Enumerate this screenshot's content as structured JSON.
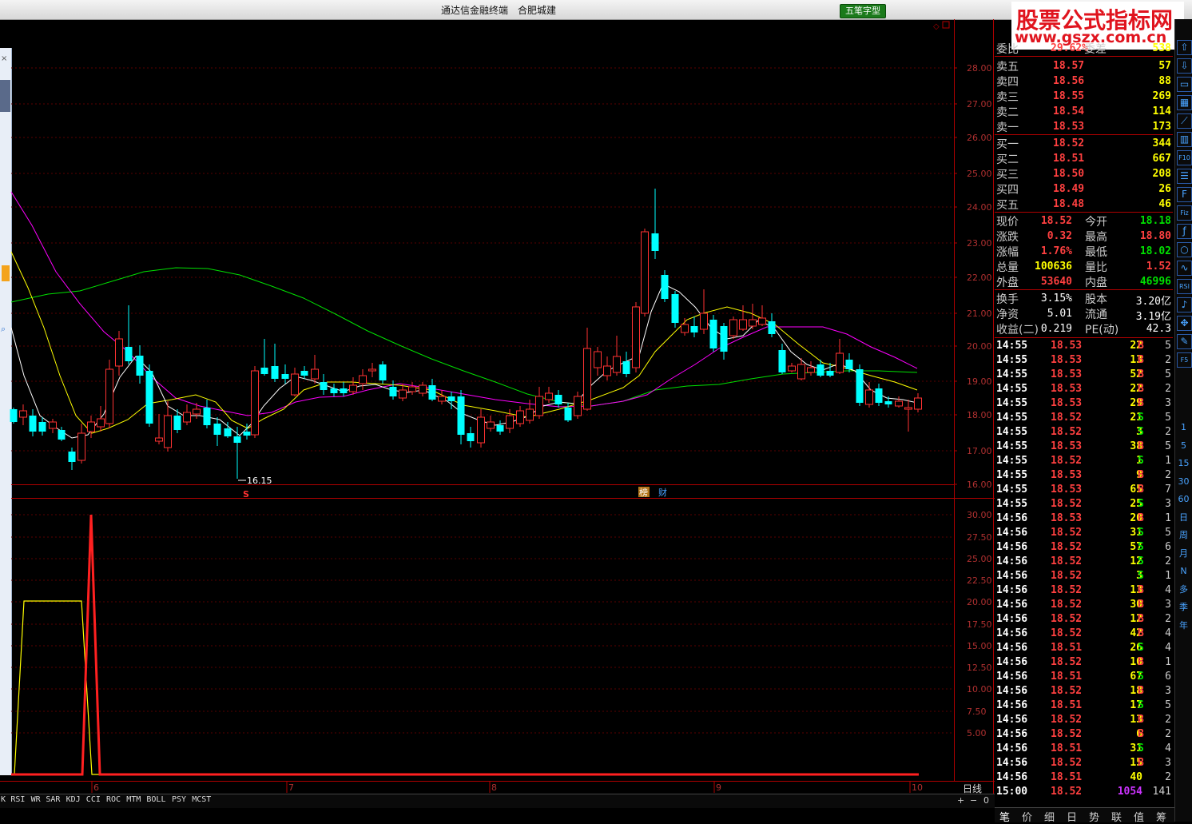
{
  "titlebar": {
    "title": "通达信金融终端　合肥城建",
    "mode_button": "五笔字型"
  },
  "logo": {
    "line1": "股票公式指标网",
    "line2": "www.gszx.com.cn"
  },
  "period_label": "日线",
  "main_chart": {
    "y_ticks": [
      "28.00",
      "27.00",
      "26.00",
      "25.00",
      "24.00",
      "23.00",
      "22.00",
      "21.00",
      "20.00",
      "19.00",
      "18.00",
      "17.00",
      "16.00"
    ],
    "low_label": "16.15",
    "event_badges": [
      "S",
      "榜",
      "财"
    ],
    "date_ticks": [
      "6",
      "7",
      "8",
      "9",
      "10"
    ],
    "colors": {
      "up": "#ff3232",
      "down": "#00ffff",
      "ma5": "#ffffff",
      "ma10": "#ffff00",
      "ma20": "#ff00ff",
      "ma60": "#00ff00"
    }
  },
  "sub_chart": {
    "y_ticks": [
      "30.00",
      "27.50",
      "25.00",
      "22.50",
      "20.00",
      "17.50",
      "15.00",
      "12.50",
      "10.00",
      "7.50",
      "5.00"
    ]
  },
  "indicator_tabs": [
    "K",
    "RSI",
    "WR",
    "SAR",
    "KDJ",
    "CCI",
    "ROC",
    "MTM",
    "BOLL",
    "PSY",
    "MCST"
  ],
  "zoom": {
    "plus": "+",
    "minus": "−",
    "value": "0"
  },
  "order_book": {
    "header": {
      "l1": "委比",
      "v1": "29.62%",
      "l2": "委差",
      "v2": "538"
    },
    "asks": [
      {
        "label": "卖五",
        "price": "18.57",
        "vol": "57"
      },
      {
        "label": "卖四",
        "price": "18.56",
        "vol": "88"
      },
      {
        "label": "卖三",
        "price": "18.55",
        "vol": "269"
      },
      {
        "label": "卖二",
        "price": "18.54",
        "vol": "114"
      },
      {
        "label": "卖一",
        "price": "18.53",
        "vol": "173"
      }
    ],
    "bids": [
      {
        "label": "买一",
        "price": "18.52",
        "vol": "344"
      },
      {
        "label": "买二",
        "price": "18.51",
        "vol": "667"
      },
      {
        "label": "买三",
        "price": "18.50",
        "vol": "208"
      },
      {
        "label": "买四",
        "price": "18.49",
        "vol": "26"
      },
      {
        "label": "买五",
        "price": "18.48",
        "vol": "46"
      }
    ]
  },
  "quote": [
    {
      "l1": "现价",
      "v1": "18.52",
      "l2": "今开",
      "v2": "18.18",
      "c1": "#ff4040",
      "c2": "#00e000"
    },
    {
      "l1": "涨跌",
      "v1": "0.32",
      "l2": "最高",
      "v2": "18.80",
      "c1": "#ff4040",
      "c2": "#ff4040"
    },
    {
      "l1": "涨幅",
      "v1": "1.76%",
      "l2": "最低",
      "v2": "18.02",
      "c1": "#ff4040",
      "c2": "#00e000"
    },
    {
      "l1": "总量",
      "v1": "100636",
      "l2": "量比",
      "v2": "1.52",
      "c1": "#ffff00",
      "c2": "#ff4040"
    },
    {
      "l1": "外盘",
      "v1": "53640",
      "l2": "内盘",
      "v2": "46996",
      "c1": "#ff4040",
      "c2": "#00e000"
    }
  ],
  "fundamentals": [
    {
      "l1": "换手",
      "v1": "3.15%",
      "l2": "股本",
      "v2": "3.20亿"
    },
    {
      "l1": "净资",
      "v1": "5.01",
      "l2": "流通",
      "v2": "3.19亿"
    },
    {
      "l1": "收益(二)",
      "v1": "0.219",
      "l2": "PE(动)",
      "v2": "42.3"
    }
  ],
  "ticks": [
    {
      "t": "14:55",
      "p": "18.53",
      "v": "22",
      "d": "B",
      "n": "5"
    },
    {
      "t": "14:55",
      "p": "18.53",
      "v": "13",
      "d": "B",
      "n": "2"
    },
    {
      "t": "14:55",
      "p": "18.53",
      "v": "52",
      "d": "B",
      "n": "5"
    },
    {
      "t": "14:55",
      "p": "18.53",
      "v": "22",
      "d": "B",
      "n": "2"
    },
    {
      "t": "14:55",
      "p": "18.53",
      "v": "29",
      "d": "B",
      "n": "3"
    },
    {
      "t": "14:55",
      "p": "18.52",
      "v": "21",
      "d": "S",
      "n": "5"
    },
    {
      "t": "14:55",
      "p": "18.52",
      "v": "3",
      "d": "S",
      "n": "2"
    },
    {
      "t": "14:55",
      "p": "18.53",
      "v": "38",
      "d": "B",
      "n": "5"
    },
    {
      "t": "14:55",
      "p": "18.52",
      "v": "1",
      "d": "S",
      "n": "1"
    },
    {
      "t": "14:55",
      "p": "18.53",
      "v": "9",
      "d": "B",
      "n": "2"
    },
    {
      "t": "14:55",
      "p": "18.53",
      "v": "65",
      "d": "B",
      "n": "7"
    },
    {
      "t": "14:55",
      "p": "18.52",
      "v": "25",
      "d": "S",
      "n": "3"
    },
    {
      "t": "14:56",
      "p": "18.53",
      "v": "20",
      "d": "B",
      "n": "1"
    },
    {
      "t": "14:56",
      "p": "18.52",
      "v": "31",
      "d": "S",
      "n": "5"
    },
    {
      "t": "14:56",
      "p": "18.52",
      "v": "57",
      "d": "S",
      "n": "6"
    },
    {
      "t": "14:56",
      "p": "18.52",
      "v": "12",
      "d": "S",
      "n": "2"
    },
    {
      "t": "14:56",
      "p": "18.52",
      "v": "3",
      "d": "S",
      "n": "1"
    },
    {
      "t": "14:56",
      "p": "18.52",
      "v": "13",
      "d": "B",
      "n": "4"
    },
    {
      "t": "14:56",
      "p": "18.52",
      "v": "30",
      "d": "B",
      "n": "3"
    },
    {
      "t": "14:56",
      "p": "18.52",
      "v": "12",
      "d": "B",
      "n": "2"
    },
    {
      "t": "14:56",
      "p": "18.52",
      "v": "42",
      "d": "B",
      "n": "4"
    },
    {
      "t": "14:56",
      "p": "18.51",
      "v": "26",
      "d": "S",
      "n": "4"
    },
    {
      "t": "14:56",
      "p": "18.52",
      "v": "10",
      "d": "B",
      "n": "1"
    },
    {
      "t": "14:56",
      "p": "18.51",
      "v": "67",
      "d": "S",
      "n": "6"
    },
    {
      "t": "14:56",
      "p": "18.52",
      "v": "18",
      "d": "B",
      "n": "3"
    },
    {
      "t": "14:56",
      "p": "18.51",
      "v": "17",
      "d": "S",
      "n": "5"
    },
    {
      "t": "14:56",
      "p": "18.52",
      "v": "13",
      "d": "B",
      "n": "2"
    },
    {
      "t": "14:56",
      "p": "18.52",
      "v": "6",
      "d": "B",
      "n": "2"
    },
    {
      "t": "14:56",
      "p": "18.51",
      "v": "31",
      "d": "S",
      "n": "4"
    },
    {
      "t": "14:56",
      "p": "18.52",
      "v": "15",
      "d": "B",
      "n": "3"
    },
    {
      "t": "14:56",
      "p": "18.51",
      "v": "40",
      "d": "",
      "n": "2"
    },
    {
      "t": "15:00",
      "p": "18.52",
      "v": "1054",
      "d": "",
      "n": "141"
    }
  ],
  "panel_tabs": [
    "笔",
    "价",
    "细",
    "日",
    "势",
    "联",
    "值",
    "筹"
  ],
  "sidebar_periods": [
    "1",
    "5",
    "15",
    "30",
    "60",
    "日",
    "周",
    "月",
    "N",
    "多",
    "季",
    "年"
  ]
}
